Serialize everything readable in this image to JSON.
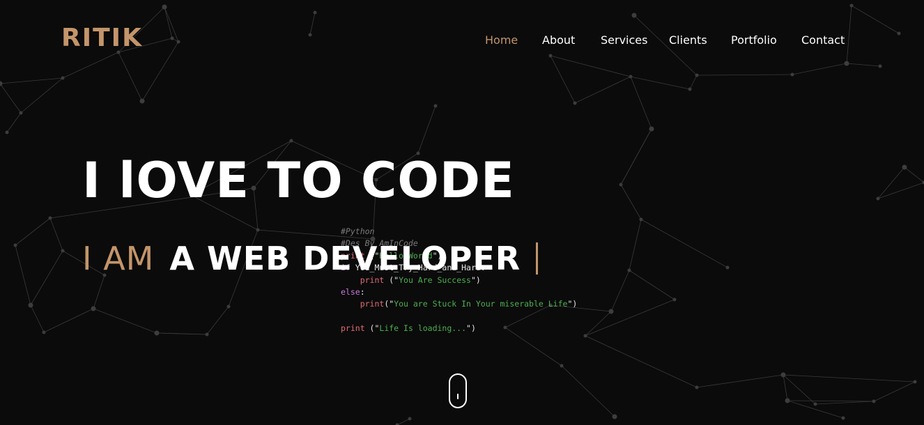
{
  "logo": {
    "text": "RITIK"
  },
  "nav": {
    "items": [
      {
        "label": "Home",
        "active": true
      },
      {
        "label": "About",
        "active": false
      },
      {
        "label": "Services",
        "active": false
      },
      {
        "label": "Clients",
        "active": false
      },
      {
        "label": "Portfolio",
        "active": false
      },
      {
        "label": "Contact",
        "active": false
      }
    ]
  },
  "hero": {
    "title": "I lOVE TO CODE",
    "subtitle_prefix": "I AM",
    "subtitle_role": "A WEB DEVELOPER"
  },
  "code": {
    "lines": [
      [
        {
          "t": "#Python",
          "c": "comment"
        }
      ],
      [
        {
          "t": "#Des By AmInCode",
          "c": "comment"
        }
      ],
      [
        {
          "t": "print",
          "c": "fn"
        },
        {
          "t": " (\"",
          "c": "plain"
        },
        {
          "t": "Hello World",
          "c": "str"
        },
        {
          "t": "\")",
          "c": "plain"
        }
      ],
      [
        {
          "t": "if",
          "c": "kw"
        },
        {
          "t": " You_Must_Try_Hard_and_Hard:",
          "c": "plain"
        }
      ],
      [
        {
          "t": "    ",
          "c": "plain"
        },
        {
          "t": "print",
          "c": "fn"
        },
        {
          "t": " (\"",
          "c": "plain"
        },
        {
          "t": "You Are Success",
          "c": "str"
        },
        {
          "t": "\")",
          "c": "plain"
        }
      ],
      [
        {
          "t": "else",
          "c": "kw"
        },
        {
          "t": ":",
          "c": "plain"
        }
      ],
      [
        {
          "t": "    ",
          "c": "plain"
        },
        {
          "t": "print",
          "c": "fn"
        },
        {
          "t": "(\"",
          "c": "plain"
        },
        {
          "t": "You are Stuck In Your miserable Life",
          "c": "str"
        },
        {
          "t": "\")",
          "c": "plain"
        }
      ],
      [
        {
          "t": "",
          "c": "plain"
        }
      ],
      [
        {
          "t": "print",
          "c": "fn"
        },
        {
          "t": " (\"",
          "c": "plain"
        },
        {
          "t": "Life Is loading...",
          "c": "str"
        },
        {
          "t": "\")",
          "c": "plain"
        }
      ]
    ]
  },
  "scroll_indicator": {
    "icon": "mouse-scroll-icon"
  },
  "colors": {
    "background": "#0b0b0b",
    "accent": "#c4956a",
    "text": "#ffffff",
    "network_line": "#3a3a3a",
    "network_node": "#3d3d3d"
  }
}
